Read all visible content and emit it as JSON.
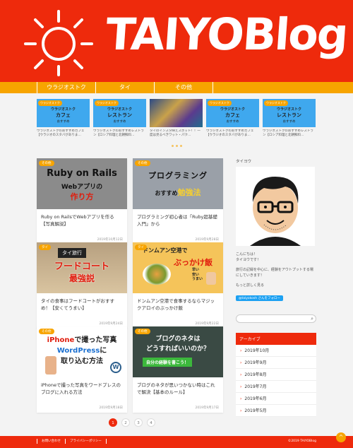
{
  "header": {
    "logo": "TAIYOBlog"
  },
  "nav": {
    "items": [
      "ウラジオストク",
      "タイ",
      "その他"
    ]
  },
  "carousel": [
    {
      "tag": "ウラジオストク",
      "t1": "ウラジオストク",
      "t2": "カフェ",
      "t3": "おすすめ",
      "caption": "ウラジオストクのおすすめカフェ【ウラジオのスタバがありま…"
    },
    {
      "tag": "ウラジオストク",
      "t1": "ウラジオストク",
      "t2": "レストラン",
      "t3": "おすすめ",
      "caption": "ウラジオストクのおすすめレストラン【ロシア料理と北朝鮮料…"
    },
    {
      "tag": "",
      "t1": "",
      "t2": "",
      "t3": "",
      "caption": "タイのインスタ映えスポット！！一度は見るべきワット・パク…"
    },
    {
      "tag": "ウラジオストク",
      "t1": "ウラジオストク",
      "t2": "カフェ",
      "t3": "おすすめ",
      "caption": "ウラジオストクのおすすめカフェ【ウラジオのスタバがありま…"
    },
    {
      "tag": "ウラジオストク",
      "t1": "ウラジオストク",
      "t2": "レストラン",
      "t3": "おすすめ",
      "caption": "ウラジオストクのおすすめレストラン【ロシア料理と北朝鮮料…"
    }
  ],
  "posts": [
    {
      "tag": "その他",
      "img": {
        "a": "Ruby on Rails",
        "b": "Webアプリの",
        "c": "作り方"
      },
      "title": "Ruby on RailsでWebアプリを作る【写真解説】",
      "date": "2019年10月12日"
    },
    {
      "tag": "その他",
      "img": {
        "a": "プログラミング",
        "b": "おすすめ",
        "c": "勉強法"
      },
      "title": "プログラミング初心者は「Ruby超基礎入門」から",
      "date": "2019年9月28日"
    },
    {
      "tag": "タイ",
      "img": {
        "a": "タイ旅行",
        "b": "フードコート",
        "c": "最強説"
      },
      "title": "タイの食事はフードコートがおすすめ！【安くてうまい】",
      "date": "2019年9月24日"
    },
    {
      "tag": "タイ",
      "img": {
        "a": "ドンムアン空港で",
        "b": "ぶっかけ飯",
        "c1": "早い",
        "c2": "安い",
        "c3": "うまい"
      },
      "title": "ドンムアン空港で食事するならマジックアロイのぶっかけ飯",
      "date": "2019年9月22日"
    },
    {
      "tag": "その他",
      "img": {
        "a1": "iPhone",
        "a2": "で撮った写真",
        "b1": "WordPress",
        "b2": "に",
        "c": "取り込む方法"
      },
      "title": "iPhoneで撮った写真をワードプレスのブログに入れる方法",
      "date": "2019年9月18日"
    },
    {
      "tag": "その他",
      "img": {
        "a": "ブログのネタは",
        "b": "どうすればいいのか？",
        "c": "自分の経験を書こう！"
      },
      "title": "ブログのネタが思いつかない時はこれで解決【基本のルール】",
      "date": "2019年9月17日"
    }
  ],
  "pagination": [
    "1",
    "2",
    "3",
    "4"
  ],
  "sidebar": {
    "name": "タイヨウ",
    "intro1": "こんにちは！",
    "intro2": "タイヨウです！",
    "intro3": "旅行の記録を中心に、経験をアウトプットする場にしていきます！",
    "more": "もっと詳しく見る",
    "follow": "@taiyokosh さんをフォロー",
    "archive_title": "アーカイブ",
    "archive": [
      "2019年10月",
      "2019年9月",
      "2019年8月",
      "2019年7月",
      "2019年6月",
      "2019年5月"
    ]
  },
  "footer": {
    "links": [
      "お問い合わせ",
      "プライバシーポリシー"
    ],
    "copy": "©2019 TAIYOBlog"
  },
  "colors": {
    "brand_red": "#ee2a0c",
    "accent_orange": "#f7a400"
  }
}
